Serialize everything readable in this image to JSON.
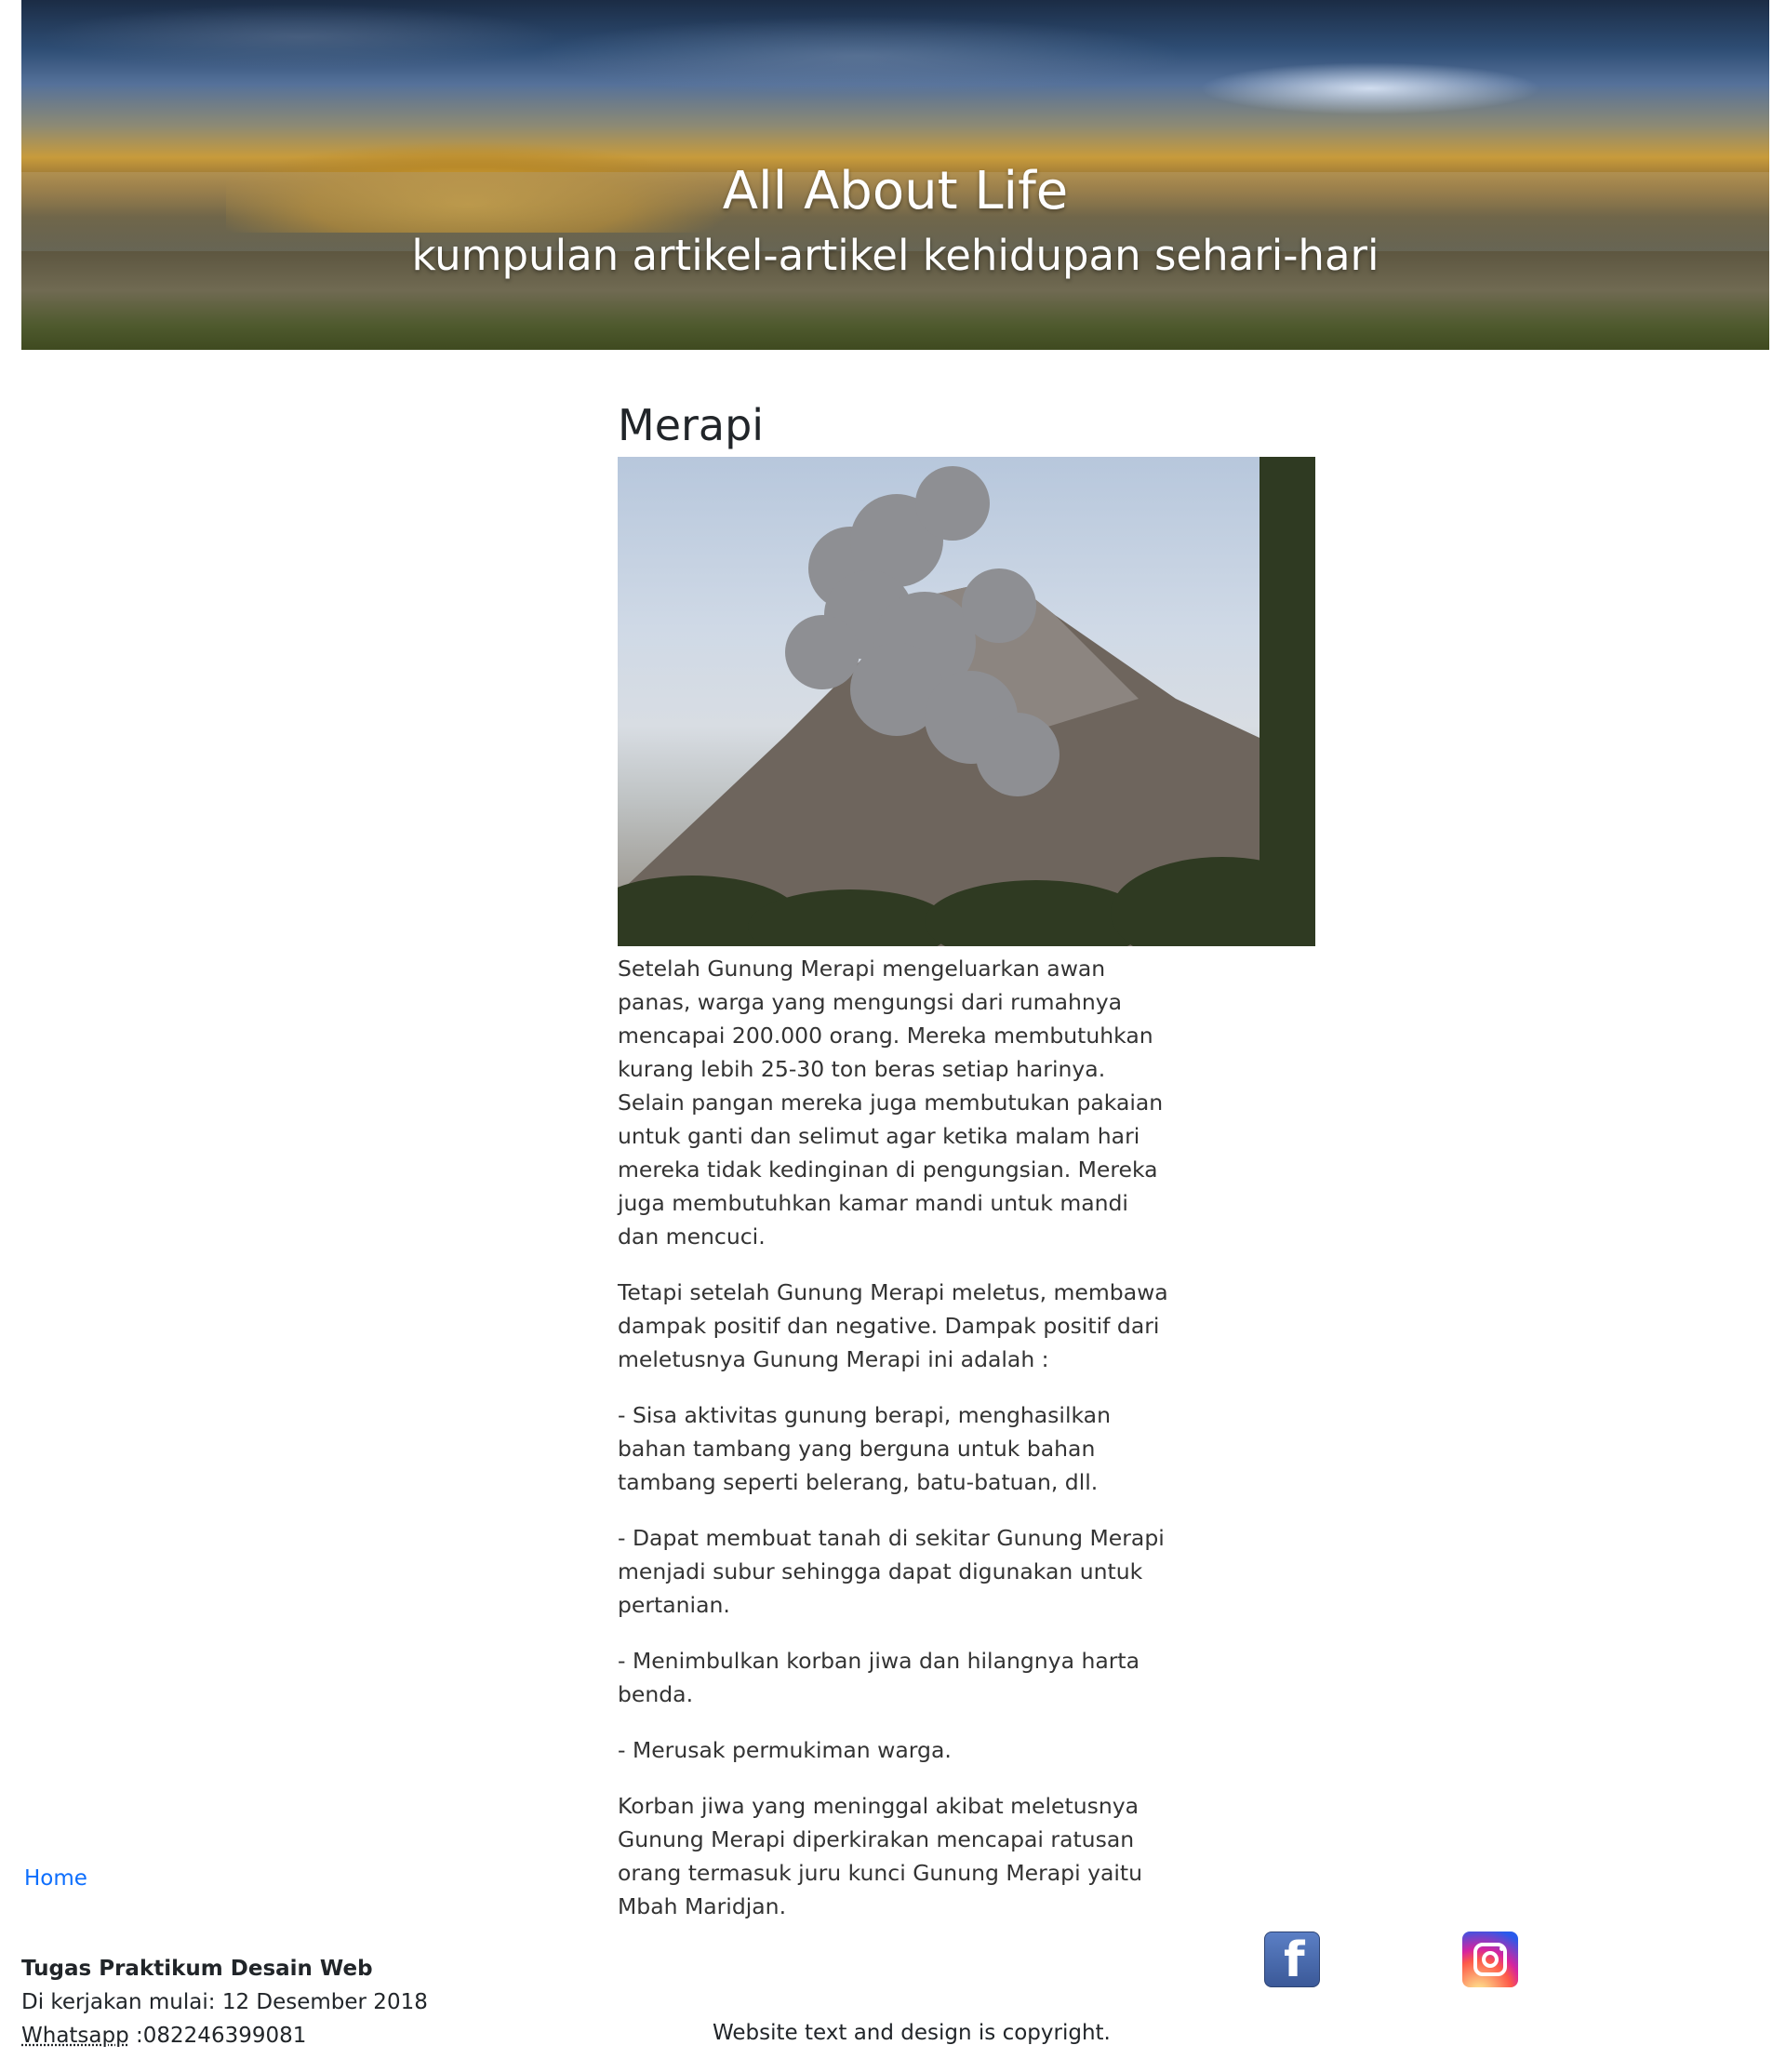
{
  "header": {
    "title": "All About Life",
    "subtitle": "kumpulan artikel-artikel kehidupan sehari-hari"
  },
  "article": {
    "heading": "Merapi",
    "image_alt": "Gunung Merapi",
    "paragraphs": [
      "Setelah Gunung Merapi mengeluarkan awan panas, warga yang mengungsi dari rumahnya mencapai 200.000 orang. Mereka membutuhkan kurang lebih 25-30 ton beras setiap harinya. Selain pangan mereka juga membutukan pakaian untuk ganti dan selimut agar ketika malam hari mereka tidak kedinginan di pengungsian. Mereka juga membutuhkan kamar mandi untuk mandi dan mencuci.",
      "Tetapi setelah Gunung Merapi meletus, membawa dampak positif dan negative. Dampak positif dari meletusnya Gunung Merapi ini adalah :",
      "- Sisa aktivitas gunung berapi, menghasilkan bahan tambang yang berguna untuk bahan tambang seperti belerang, batu-batuan, dll.",
      "- Dapat membuat tanah di sekitar Gunung Merapi menjadi subur sehingga dapat digunakan untuk pertanian.",
      "- Menimbulkan korban jiwa dan hilangnya harta benda.",
      "- Merusak permukiman warga.",
      "Korban jiwa yang meninggal akibat meletusnya Gunung Merapi diperkirakan mencapai ratusan orang termasuk juru kunci Gunung Merapi yaitu Mbah Maridjan."
    ]
  },
  "footer": {
    "home_link": "Home",
    "course": "Tugas Praktikum Desain Web",
    "started": "Di kerjakan mulai: 12 Desember 2018",
    "whatsapp_label": "Whatsapp",
    "whatsapp_number": " :082246399081",
    "copyright": "Website text and design is copyright.",
    "social": {
      "facebook_icon": "facebook-icon",
      "instagram_icon": "instagram-icon"
    }
  },
  "colors": {
    "link": "#0d6efd",
    "text": "#212529"
  }
}
